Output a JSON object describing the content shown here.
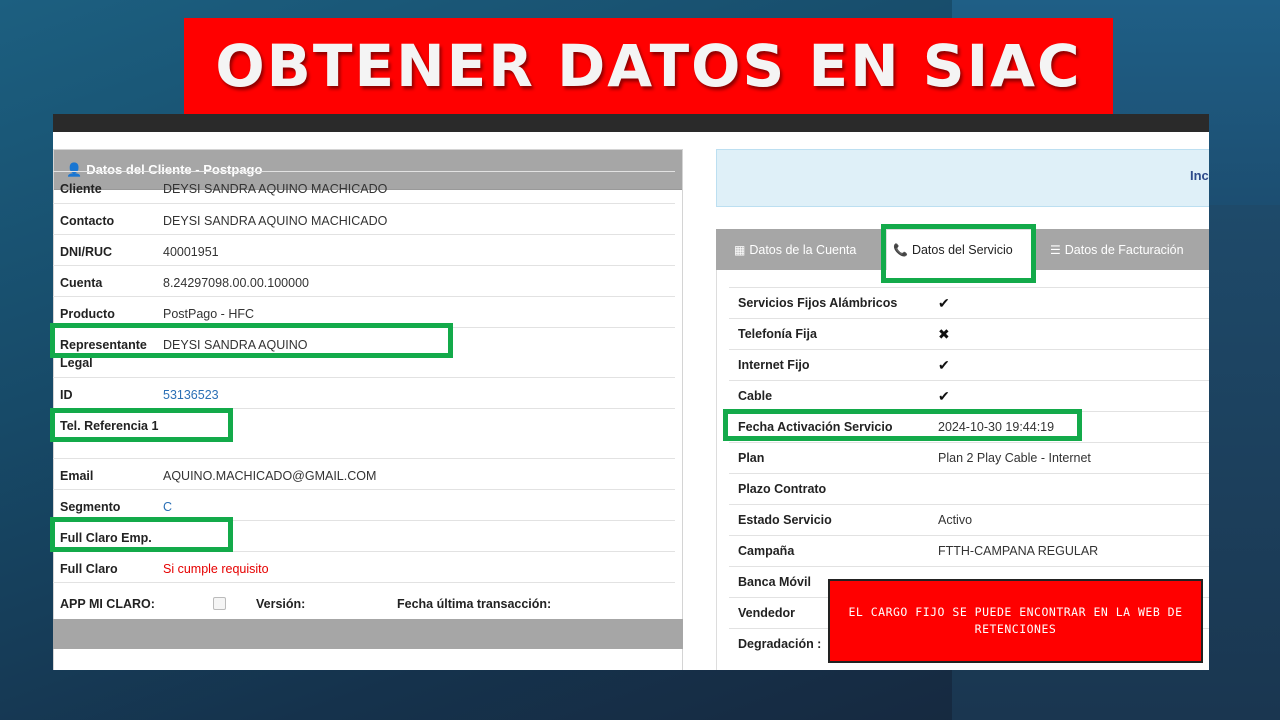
{
  "banner": {
    "title": "OBTENER DATOS EN SIAC"
  },
  "left_panel": {
    "heading": "Datos del Cliente - Postpago",
    "heading_icon": "user-icon",
    "rows": [
      {
        "key": "Cliente",
        "value": "DEYSI SANDRA AQUINO MACHICADO"
      },
      {
        "key": "Contacto",
        "value": "DEYSI SANDRA AQUINO MACHICADO"
      },
      {
        "key": "DNI/RUC",
        "value": "40001951"
      },
      {
        "key": "Cuenta",
        "value": "8.24297098.00.00.100000"
      },
      {
        "key": "Producto",
        "value": "PostPago - HFC"
      },
      {
        "key": "Representante Legal",
        "value": "DEYSI SANDRA AQUINO"
      },
      {
        "key": "ID",
        "value": "53136523"
      },
      {
        "key": "Tel. Referencia 1",
        "value": ""
      },
      {
        "key": "Email",
        "value": "AQUINO.MACHICADO@GMAIL.COM"
      },
      {
        "key": "Segmento",
        "value": "C"
      },
      {
        "key": "Full Claro Emp.",
        "value": ""
      },
      {
        "key": "Full Claro",
        "value": "Si cumple requisito"
      }
    ],
    "app_row": {
      "app_label": "APP MI CLARO:",
      "version_label": "Versión:",
      "last_tx_label": "Fecha última transacción:"
    }
  },
  "info_box": {
    "text": "Inc"
  },
  "tabs": [
    {
      "label": "Datos de la Cuenta",
      "icon": "grid-icon"
    },
    {
      "label": "Datos del Servicio",
      "icon": "phone-icon"
    },
    {
      "label": "Datos de Facturación",
      "icon": "list-icon"
    }
  ],
  "service": {
    "rows": [
      {
        "key": "Servicios Fijos Alámbricos",
        "value": "✔"
      },
      {
        "key": "Telefonía Fija",
        "value": "✖"
      },
      {
        "key": "Internet Fijo",
        "value": "✔"
      },
      {
        "key": "Cable",
        "value": "✔"
      },
      {
        "key": "Fecha Activación Servicio",
        "value": "2024-10-30 19:44:19"
      },
      {
        "key": "Plan",
        "value": "Plan 2 Play Cable - Internet"
      },
      {
        "key": "Plazo Contrato",
        "value": ""
      },
      {
        "key": "Estado Servicio",
        "value": "Activo"
      },
      {
        "key": "Campaña",
        "value": "FTTH-CAMPANA REGULAR"
      },
      {
        "key": "Banca Móvil",
        "value": ""
      },
      {
        "key": "Vendedor",
        "value": ""
      },
      {
        "key": "Degradación :",
        "value": ""
      }
    ]
  },
  "note": {
    "text": "EL CARGO FIJO SE PUEDE ENCONTRAR EN LA WEB DE RETENCIONES"
  },
  "colors": {
    "highlight": "#13aa4a",
    "banner": "#ff0000",
    "panel_heading": "#a6a6a6",
    "link": "#2a6fb5"
  }
}
